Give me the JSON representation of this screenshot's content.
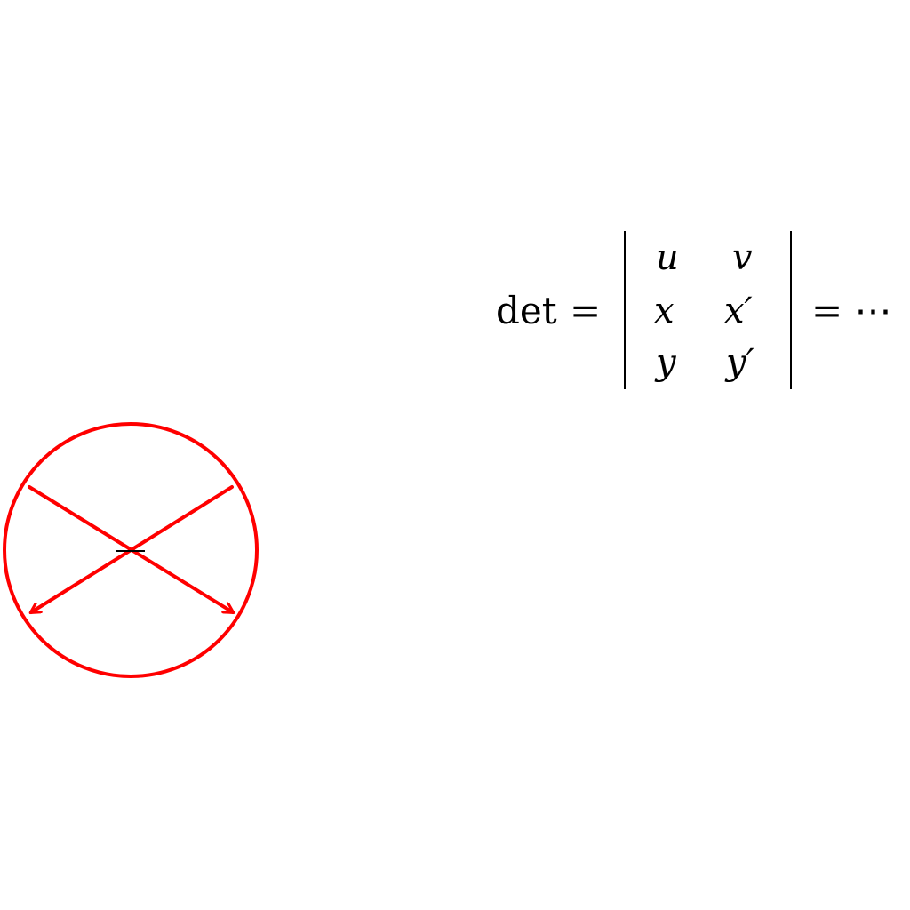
{
  "diagram": {
    "circle_color": "#ff0000",
    "center_mark_color": "#000000",
    "center_mark_symbol": "−",
    "arrow_heads": "left-down and right-down",
    "equation": {
      "lhs": "det",
      "equals": "=",
      "matrix": {
        "rows": [
          [
            "u",
            "v"
          ],
          [
            "x",
            "x′"
          ],
          [
            "y",
            "y′"
          ]
        ]
      },
      "tail": "= ⋯"
    }
  }
}
